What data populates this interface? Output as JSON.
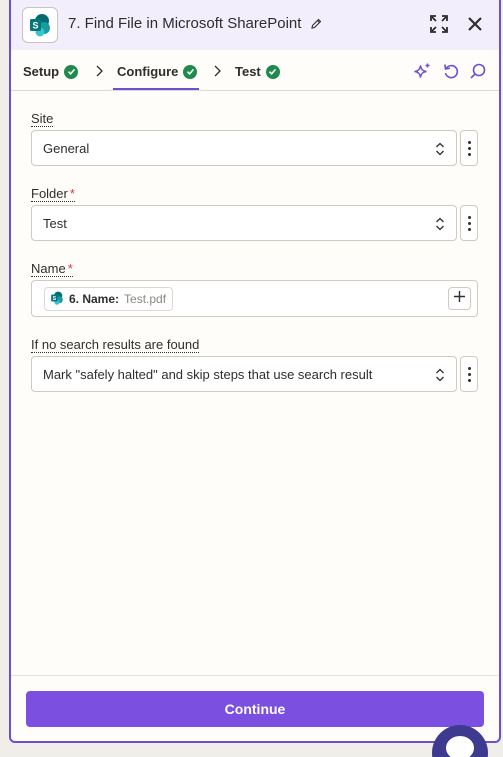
{
  "header": {
    "title": "7. Find File in Microsoft SharePoint",
    "app_icon": "sharepoint-icon"
  },
  "tabs": [
    {
      "label": "Setup",
      "status": "complete"
    },
    {
      "label": "Configure",
      "status": "complete",
      "active": true
    },
    {
      "label": "Test",
      "status": "complete"
    }
  ],
  "fields": {
    "site": {
      "label": "Site",
      "value": "General"
    },
    "folder": {
      "label": "Folder",
      "value": "Test",
      "required_mark": "*"
    },
    "name": {
      "label": "Name",
      "required_mark": "*",
      "step_label": "6. Name:",
      "step_value": "Test.pdf"
    },
    "no_results": {
      "label": "If no search results are found",
      "value": "Mark \"safely halted\" and skip steps that use search result"
    }
  },
  "footer": {
    "continue_label": "Continue"
  },
  "colors": {
    "accent": "#6e4fd0",
    "button": "#7b4fe0",
    "success": "#1f8a4c",
    "required": "#d93a3a",
    "sharepoint": "#038387"
  }
}
